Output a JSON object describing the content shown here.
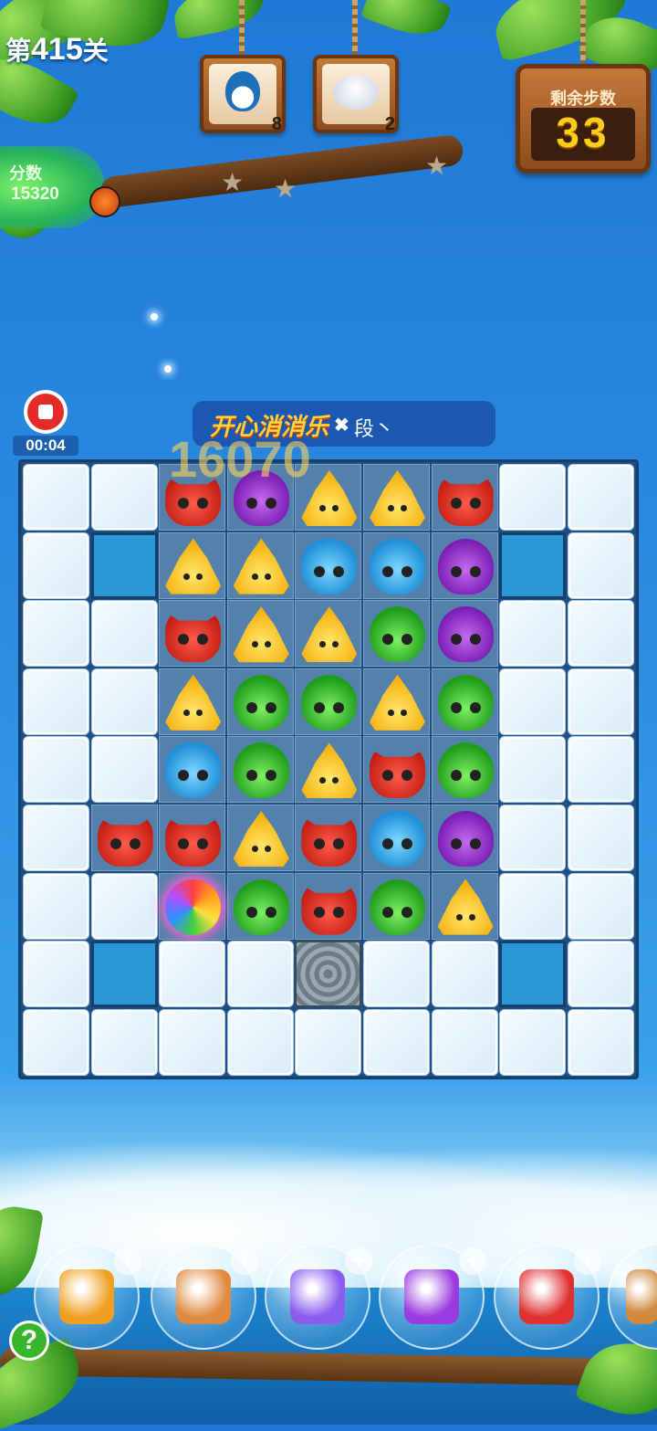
{
  "header": {
    "level_prefix": "第",
    "level_number": "415",
    "level_suffix": "关",
    "score_label": "分数",
    "score_value": "15320",
    "moves_label": "剩余步数",
    "moves_value": "33",
    "goals": [
      {
        "icon": "penguin-icon",
        "count": "8"
      },
      {
        "icon": "seal-icon",
        "count": "2"
      }
    ],
    "stars_total": 3
  },
  "recording": {
    "time": "00:04"
  },
  "banner": {
    "logo_text": "开心消消乐",
    "close_glyph": "✖",
    "text": "段丶"
  },
  "popup_score": "16070",
  "board": {
    "columns": 9,
    "rows": 9,
    "legend": {
      "I": "ice-block",
      "E": "empty-hole",
      "S": "stone-block",
      "F": "floor",
      "fox": "red-fox",
      "owl": "purple-owl",
      "chick": "yellow-chick",
      "hippo": "blue-hippo",
      "frog": "green-frog",
      "rainbow": "rainbow-bird"
    },
    "grid": [
      [
        "I",
        "I",
        "fox",
        "owl",
        "chick",
        "chick",
        "fox",
        "I",
        "I"
      ],
      [
        "I",
        "E",
        "chick",
        "chick",
        "hippo",
        "hippo",
        "owl",
        "E",
        "I"
      ],
      [
        "I",
        "I",
        "fox",
        "chick*",
        "chick",
        "frog",
        "owl",
        "I",
        "I"
      ],
      [
        "I",
        "I",
        "chick",
        "frog",
        "frog",
        "chick",
        "frog",
        "I",
        "I"
      ],
      [
        "I",
        "I",
        "hippo",
        "frog",
        "chick",
        "fox",
        "frog",
        "I",
        "I"
      ],
      [
        "I",
        "fox",
        "fox",
        "chick*",
        "fox",
        "hippo",
        "owl",
        "I",
        "I"
      ],
      [
        "I",
        "I",
        "rainbow",
        "frog",
        "fox",
        "frog",
        "chick",
        "I",
        "I"
      ],
      [
        "I",
        "E",
        "I",
        "I",
        "S",
        "I",
        "I",
        "E",
        "I"
      ],
      [
        "I",
        "I",
        "I",
        "I",
        "I",
        "I",
        "I",
        "I",
        "I"
      ]
    ]
  },
  "boosters": [
    {
      "name": "shuffle-booster",
      "icon": "shuffle-icon",
      "color": "#f0a020"
    },
    {
      "name": "undo-booster",
      "icon": "clock-undo-icon",
      "color": "#e08a40"
    },
    {
      "name": "swap-booster",
      "icon": "swap-icon",
      "color": "#8a5cf0"
    },
    {
      "name": "row-rocket-booster",
      "icon": "purple-rocket-icon",
      "color": "#9a3ae0"
    },
    {
      "name": "column-rocket-booster",
      "icon": "red-rocket-icon",
      "color": "#e03030"
    },
    {
      "name": "hammer-booster",
      "icon": "hammer-icon",
      "color": "#d08a40"
    }
  ],
  "help": {
    "glyph": "?"
  }
}
